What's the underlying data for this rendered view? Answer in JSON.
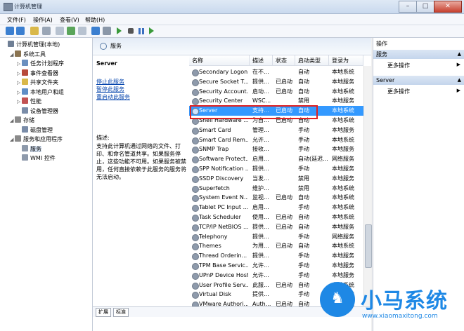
{
  "window": {
    "title": "计算机管理"
  },
  "menu": [
    "文件(F)",
    "操作(A)",
    "查看(V)",
    "帮助(H)"
  ],
  "tree": [
    {
      "label": "计算机管理(本地)",
      "level": 0,
      "expander": "",
      "color": "#6f7f95"
    },
    {
      "label": "系统工具",
      "level": 1,
      "expander": "◢",
      "color": "#8a7350"
    },
    {
      "label": "任务计划程序",
      "level": 2,
      "expander": "▷",
      "color": "#6a8fbf"
    },
    {
      "label": "事件查看器",
      "level": 2,
      "expander": "▷",
      "color": "#b84a3a"
    },
    {
      "label": "共享文件夹",
      "level": 2,
      "expander": "▷",
      "color": "#d9b84a"
    },
    {
      "label": "本地用户和组",
      "level": 2,
      "expander": "▷",
      "color": "#5f8ec6"
    },
    {
      "label": "性能",
      "level": 2,
      "expander": "▷",
      "color": "#c25252"
    },
    {
      "label": "设备管理器",
      "level": 2,
      "expander": "",
      "color": "#7a8ca8"
    },
    {
      "label": "存储",
      "level": 1,
      "expander": "◢",
      "color": "#8a8a8a"
    },
    {
      "label": "磁盘管理",
      "level": 2,
      "expander": "",
      "color": "#7a8ca8"
    },
    {
      "label": "服务和应用程序",
      "level": 1,
      "expander": "◢",
      "color": "#8a8a8a"
    },
    {
      "label": "服务",
      "level": 2,
      "expander": "",
      "color": "#8e9aab",
      "selected": true
    },
    {
      "label": "WMI 控件",
      "level": 2,
      "expander": "",
      "color": "#8e9aab"
    }
  ],
  "services_header": "服务",
  "detail": {
    "name": "Server",
    "links": [
      "停止此服务",
      "暂停此服务",
      "重启动此服务"
    ],
    "desc_label": "描述:",
    "desc": "支持此计算机通过网络的文件、打印、和命名管道共享。如果服务停止，这些功能不可用。如果服务被禁用，任何直接依赖于此服务的服务将无法启动。"
  },
  "columns": [
    "名称",
    "描述",
    "状态",
    "启动类型",
    "登录为"
  ],
  "services": [
    {
      "name": "Secondary Logon",
      "desc": "在不...",
      "status": "",
      "startup": "自动",
      "logon": "本地系统"
    },
    {
      "name": "Secure Socket T...",
      "desc": "提供...",
      "status": "已启动",
      "startup": "自动",
      "logon": "本地服务"
    },
    {
      "name": "Security Account...",
      "desc": "启动...",
      "status": "已启动",
      "startup": "自动",
      "logon": "本地系统"
    },
    {
      "name": "Security Center",
      "desc": "WSC...",
      "status": "",
      "startup": "禁用",
      "logon": "本地服务"
    },
    {
      "name": "Server",
      "desc": "支持...",
      "status": "已启动",
      "startup": "自动",
      "logon": "本地系统",
      "selected": true
    },
    {
      "name": "Shell Hardware ...",
      "desc": "为自...",
      "status": "已启动",
      "startup": "自动",
      "logon": "本地系统"
    },
    {
      "name": "Smart Card",
      "desc": "管理...",
      "status": "",
      "startup": "手动",
      "logon": "本地服务"
    },
    {
      "name": "Smart Card Rem...",
      "desc": "允许...",
      "status": "",
      "startup": "手动",
      "logon": "本地系统"
    },
    {
      "name": "SNMP Trap",
      "desc": "接收...",
      "status": "",
      "startup": "手动",
      "logon": "本地服务"
    },
    {
      "name": "Software Protect...",
      "desc": "启用...",
      "status": "",
      "startup": "自动(延迟...",
      "logon": "网络服务"
    },
    {
      "name": "SPP Notification ...",
      "desc": "提供...",
      "status": "",
      "startup": "手动",
      "logon": "本地服务"
    },
    {
      "name": "SSDP Discovery",
      "desc": "当发...",
      "status": "",
      "startup": "禁用",
      "logon": "本地服务"
    },
    {
      "name": "Superfetch",
      "desc": "维护...",
      "status": "",
      "startup": "禁用",
      "logon": "本地系统"
    },
    {
      "name": "System Event N...",
      "desc": "监视...",
      "status": "已启动",
      "startup": "自动",
      "logon": "本地系统"
    },
    {
      "name": "Tablet PC Input ...",
      "desc": "启用...",
      "status": "",
      "startup": "手动",
      "logon": "本地系统"
    },
    {
      "name": "Task Scheduler",
      "desc": "使用...",
      "status": "已启动",
      "startup": "自动",
      "logon": "本地系统"
    },
    {
      "name": "TCP/IP NetBIOS ...",
      "desc": "提供...",
      "status": "已启动",
      "startup": "自动",
      "logon": "本地服务"
    },
    {
      "name": "Telephony",
      "desc": "提供...",
      "status": "",
      "startup": "手动",
      "logon": "网络服务"
    },
    {
      "name": "Themes",
      "desc": "为用...",
      "status": "已启动",
      "startup": "自动",
      "logon": "本地系统"
    },
    {
      "name": "Thread Orderin...",
      "desc": "提供...",
      "status": "",
      "startup": "手动",
      "logon": "本地服务"
    },
    {
      "name": "TPM Base Servic...",
      "desc": "允许...",
      "status": "",
      "startup": "手动",
      "logon": "本地服务"
    },
    {
      "name": "UPnP Device Host",
      "desc": "允许...",
      "status": "",
      "startup": "手动",
      "logon": "本地服务"
    },
    {
      "name": "User Profile Serv...",
      "desc": "此服...",
      "status": "已启动",
      "startup": "自动",
      "logon": "本地系统"
    },
    {
      "name": "Virtual Disk",
      "desc": "提供...",
      "status": "",
      "startup": "手动",
      "logon": "本地系统"
    },
    {
      "name": "VMware Authori...",
      "desc": "Auth...",
      "status": "已启动",
      "startup": "自动",
      "logon": "本地系统"
    }
  ],
  "tabs": [
    "扩展",
    "标准"
  ],
  "actions": {
    "title": "操作",
    "sections": [
      {
        "label": "服务",
        "item": "更多操作"
      },
      {
        "label": "Server",
        "item": "更多操作"
      }
    ]
  },
  "watermark": {
    "brand": "小马系统",
    "url": "www.xiaomaxitong.com"
  },
  "colors": {
    "selection": "#3399ff",
    "highlight_box": "#e02020",
    "brand": "#1e88e5"
  }
}
